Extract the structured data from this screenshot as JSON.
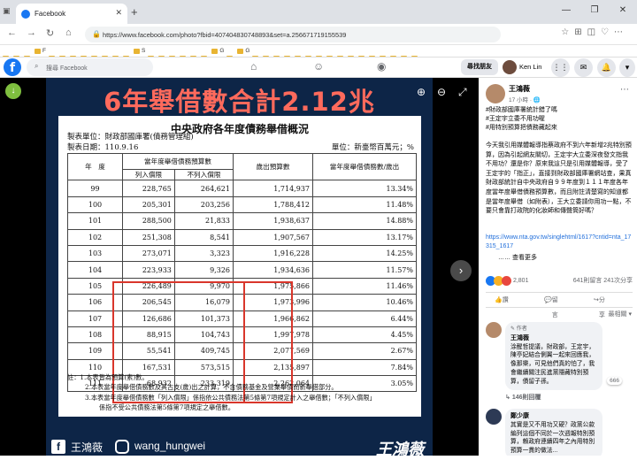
{
  "browser": {
    "tab_title": "Facebook",
    "tab_close": "✕",
    "new_tab": "+",
    "window_buttons": [
      "—",
      "❐",
      "✕"
    ],
    "url": "https://www.facebook.com/photo?fbid=407404830748893&set=a.256671719155539",
    "bookmarks": [
      "",
      "",
      "",
      "F",
      "",
      "",
      "",
      "",
      "",
      "",
      "",
      "",
      "S",
      "",
      "",
      "",
      "",
      "",
      "",
      "G",
      "",
      "G",
      "",
      "",
      "",
      "",
      "",
      "",
      "",
      "",
      "",
      "",
      "",
      "",
      "",
      "",
      "",
      ""
    ]
  },
  "facebook": {
    "logo": "f",
    "search_placeholder": "搜尋 Facebook",
    "find_friends": "尋找朋友",
    "user_name": "Ken Lin"
  },
  "photo": {
    "headline": "6年舉借數合計2.12兆",
    "sheet_title": "中央政府各年度債務舉借概況",
    "unit_org": "製表單位：財政部國庫署(債務管理組)",
    "date": "製表日期：110.9.16",
    "unit": "單位：新臺幣百萬元；%",
    "columns": {
      "year": "年　度",
      "group": "當年度舉借債務預算數",
      "listed": "列入償限",
      "not_listed": "不列入償限",
      "expenditure": "歲出預算數",
      "ratio": "當年度舉借債務數/歲出"
    },
    "rows": [
      {
        "year": "99",
        "listed": "228,765",
        "not_listed": "264,621",
        "expenditure": "1,714,937",
        "ratio": "13.34%"
      },
      {
        "year": "100",
        "listed": "205,301",
        "not_listed": "203,256",
        "expenditure": "1,788,412",
        "ratio": "11.48%"
      },
      {
        "year": "101",
        "listed": "288,500",
        "not_listed": "21,833",
        "expenditure": "1,938,637",
        "ratio": "14.88%"
      },
      {
        "year": "102",
        "listed": "251,308",
        "not_listed": "8,541",
        "expenditure": "1,907,567",
        "ratio": "13.17%"
      },
      {
        "year": "103",
        "listed": "273,071",
        "not_listed": "3,323",
        "expenditure": "1,916,228",
        "ratio": "14.25%"
      },
      {
        "year": "104",
        "listed": "223,933",
        "not_listed": "9,326",
        "expenditure": "1,934,636",
        "ratio": "11.57%"
      },
      {
        "year": "105",
        "listed": "226,489",
        "not_listed": "9,970",
        "expenditure": "1,975,866",
        "ratio": "11.46%"
      },
      {
        "year": "106",
        "listed": "206,545",
        "not_listed": "16,079",
        "expenditure": "1,973,996",
        "ratio": "10.46%"
      },
      {
        "year": "107",
        "listed": "126,686",
        "not_listed": "101,373",
        "expenditure": "1,966,862",
        "ratio": "6.44%"
      },
      {
        "year": "108",
        "listed": "88,915",
        "not_listed": "104,743",
        "expenditure": "1,997,978",
        "ratio": "4.45%"
      },
      {
        "year": "109",
        "listed": "55,541",
        "not_listed": "409,745",
        "expenditure": "2,077,569",
        "ratio": "2.67%"
      },
      {
        "year": "110",
        "listed": "167,531",
        "not_listed": "573,515",
        "expenditure": "2,135,897",
        "ratio": "7.84%"
      },
      {
        "year": "111",
        "listed": "68,932",
        "not_listed": "233,319",
        "expenditure": "2,262,064",
        "ratio": "3.05%"
      }
    ],
    "notes": [
      "註：1.本表皆為預算(素)數。",
      "2.本表當年度舉借債務數及其占支(歲)出之計算，不含債務基金及營業舉債而新舉借部分。",
      "3.本表當年度舉借債務數「列入償限」係指依公共債務法第5條第7項規定計入之舉借數；「不列入償限」",
      "係指不受公共債務法第5條第7項規定之舉借數。"
    ],
    "footer_fb": "王鴻薇",
    "footer_ig": "wang_hungwei",
    "footer_sig": "王鴻薇",
    "accent": "#ff6a5c",
    "highlight": "#d9362b"
  },
  "post": {
    "author": "王鴻薇",
    "time": "17 小時 · 🌐",
    "tags": [
      "#財政部國庫署統計錯了嗎",
      "#王定宇立委不用功喔",
      "#用特別預算把債務藏起來"
    ],
    "body": "今天我引用媒體報導指蔡政府不到六年新增2兆特別預算，因為引起網友關切，王定宇大立委深夜發文指我不用功？還是你？原來我這只是引用媒體報導，受了王定宇的「指正」，直接到財政部國庫署網站查，果真財政部統計自中央政府自９９年度到１１１年度各年度當年度舉借債務預算數，而且附註清楚寫的知道都是當年度舉借（如附表），王大立委請你用功一點，不要只會靠打政院的化妝師和傳聲筒好嗎？",
    "link": "https://www.nta.gov.tw/singlehtml/1617?cntid=nta_17315_1617",
    "see_more": "…… 查看更多",
    "reactions": "2,801",
    "stats": "641則留言  241次分享",
    "like": "讚",
    "comment": "留言",
    "share": "分享",
    "sort": "最相關 ▾"
  },
  "comments": [
    {
      "name": "王鴻薇",
      "author_label": "作者",
      "text": "涂醒哲提議，財政部，王定宇，陳亭妃結合側翼一起來回應我，像那樂，可見他們真的怕了，我會繼續關注民進黨隱藏特別預算，債留子孫。",
      "count": "666",
      "replies": "146則回覆"
    },
    {
      "name": "鄭少康",
      "text": "其實是又不用功又硬？政黨公款編列這個不同於一次週報特別預算，賴政府連續四年之內用特別預算一貫的做法...",
      "count": ""
    }
  ]
}
